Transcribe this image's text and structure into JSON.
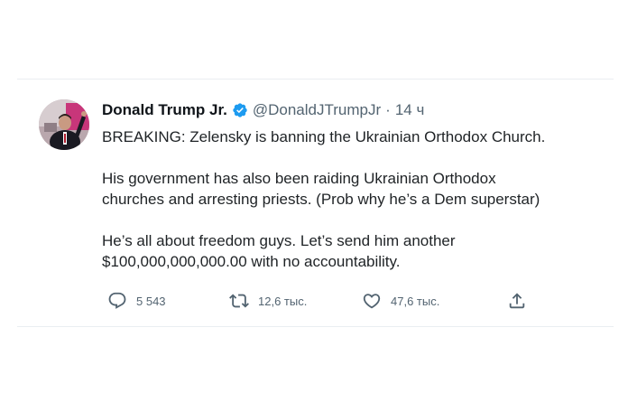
{
  "tweet": {
    "author": {
      "display_name": "Donald Trump Jr.",
      "verified": true,
      "handle": "@DonaldJTrumpJr",
      "separator": "·",
      "time": "14 ч"
    },
    "paragraphs": [
      "BREAKING: Zelensky is banning the Ukrainian Orthodox Church.",
      "His government has also been raiding Ukrainian Orthodox\nchurches and arresting priests. (Prob why he’s a Dem superstar)",
      "He’s all about freedom guys. Let’s send him another\n$100,000,000,000.00 with no accountability."
    ],
    "actions": {
      "reply_count": "5 543",
      "retweet_count": "12,6 тыс.",
      "like_count": "47,6 тыс."
    }
  },
  "icons": {
    "verified": "verified-badge-icon",
    "reply": "comment-bubble-icon",
    "retweet": "retweet-arrows-icon",
    "like": "heart-outline-icon",
    "share": "share-upload-icon"
  },
  "colors": {
    "verified_blue": "#1d9bf0",
    "muted_text": "#536471",
    "text": "#0f1419"
  }
}
